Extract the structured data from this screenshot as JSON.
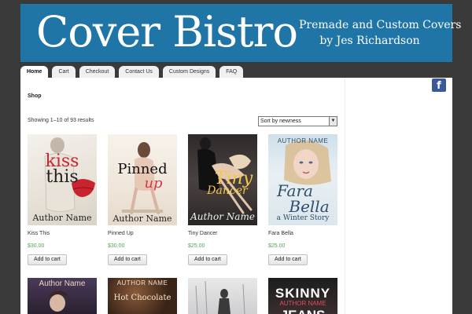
{
  "banner": {
    "title": "Cover Bistro",
    "tagline_line1": "Premade and Custom Covers",
    "tagline_line2": "by Jes Richardson"
  },
  "nav": {
    "tabs": [
      "Home",
      "Cart",
      "Checkout",
      "Contact Us",
      "Custom Designs",
      "FAQ"
    ],
    "active": "Home"
  },
  "social": {
    "facebook_icon": "f"
  },
  "shop": {
    "title": "Shop",
    "result_count": "Showing 1–10 of 93 results",
    "sort_selected": "Sort by newness"
  },
  "products": [
    {
      "name": "Kiss This",
      "price": "$30.00",
      "button": "Add to cart",
      "cover_line1": "kiss",
      "cover_line2": "this",
      "cover_author": "Author Name"
    },
    {
      "name": "Pinned Up",
      "price": "$30.00",
      "button": "Add to cart",
      "cover_line1": "Pinned",
      "cover_line2": "up",
      "cover_author": "Author Name"
    },
    {
      "name": "Tiny Dancer",
      "price": "$25.00",
      "button": "Add to cart",
      "cover_line1": "Tiny",
      "cover_line2": "Dancer",
      "cover_author": "Author Name"
    },
    {
      "name": "Fara Bella",
      "price": "$25.00",
      "button": "Add to cart",
      "cover_author": "AUTHOR NAME",
      "cover_line1": "Fara",
      "cover_line2": "Bella",
      "cover_sub": "a Winter Story"
    }
  ],
  "row2_covers": [
    {
      "line1": "Author Name",
      "line2": ""
    },
    {
      "line1": "AUTHOR NAME",
      "line2": "Hot Chocolate"
    },
    {
      "line1": "",
      "line2": ""
    },
    {
      "line1": "SKINNY",
      "line2": "AUTHOR NAME",
      "line3": "JEANS"
    }
  ],
  "colors": {
    "banner": "#1f75a6",
    "background": "#3a3a3a",
    "price": "#5aa05a"
  }
}
